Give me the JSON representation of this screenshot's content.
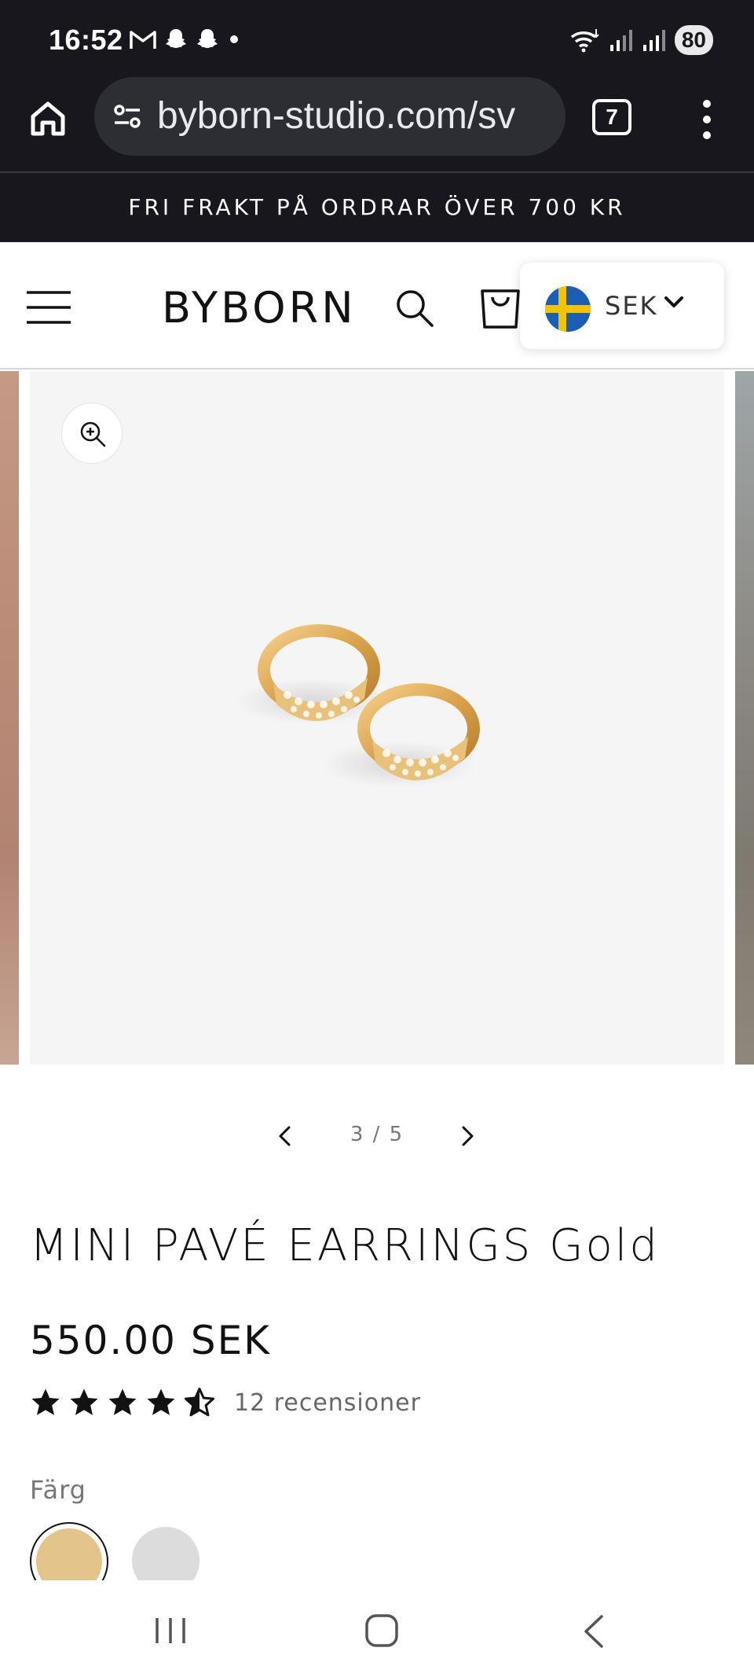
{
  "status_bar": {
    "time": "16:52",
    "battery": "80",
    "icons": [
      "gmail-icon",
      "snapchat-icon",
      "snapchat-icon",
      "dot-icon",
      "wifi-icon",
      "signal-icon",
      "signal-icon"
    ]
  },
  "browser": {
    "url": "byborn-studio.com/sv",
    "tab_count": "7",
    "icons": [
      "home-icon",
      "site-settings-icon",
      "more-vert-icon"
    ]
  },
  "announcement": {
    "text": "FRI FRAKT PÅ ORDRAR ÖVER 700 KR"
  },
  "header": {
    "logo": "BYBORN",
    "currency": "SEK",
    "icons": [
      "menu-icon",
      "search-icon",
      "cart-icon",
      "sweden-flag-icon",
      "chevron-down-icon"
    ]
  },
  "gallery": {
    "counter": "3 / 5",
    "current": 3,
    "total": 5,
    "background": "#f5f5f5",
    "icons": [
      "zoom-in-icon",
      "chevron-left-icon",
      "chevron-right-icon"
    ]
  },
  "product": {
    "title": "MINI PAVÉ EARRINGS Gold",
    "price": "550.00 SEK",
    "rating": 4.5,
    "reviews": "12 recensioner",
    "color_label": "Färg",
    "swatches": [
      {
        "name": "Gold",
        "color": "#e3c58c",
        "selected": true
      },
      {
        "name": "Silver",
        "color": "#dcdcdc",
        "selected": false
      }
    ]
  },
  "nav_bar": {
    "icons": [
      "recents-icon",
      "home-icon",
      "back-icon"
    ]
  },
  "colors": {
    "chrome_dark": "#17171d",
    "url_bar": "#2d2e34",
    "text": "#121212",
    "muted": "#777777"
  }
}
